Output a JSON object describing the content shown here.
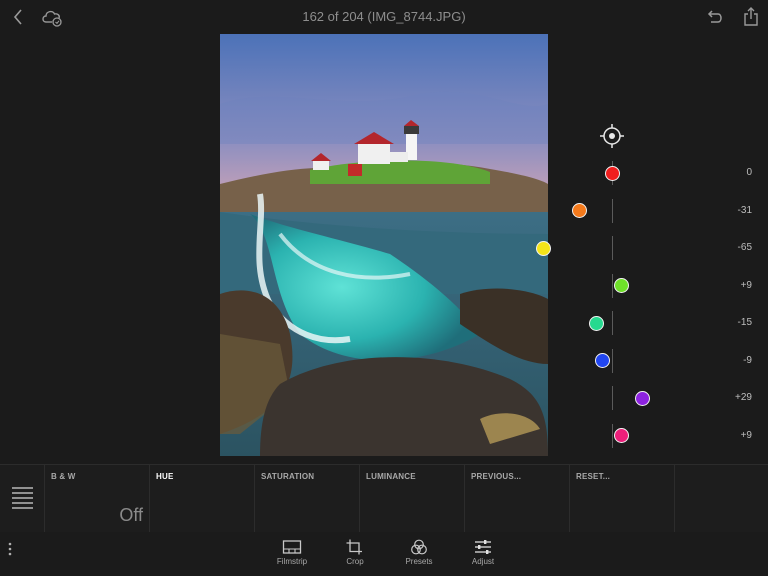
{
  "header": {
    "title": "162 of 204 (IMG_8744.JPG)",
    "icons": [
      "chevron-left-icon",
      "cloud-sync-icon",
      "undo-icon",
      "share-icon"
    ]
  },
  "hue_panel": {
    "target_tool_icon": "target-adjust-icon",
    "channels": [
      {
        "color": "#f01e1e",
        "value": "0",
        "level": 0
      },
      {
        "color": "#f47a1c",
        "value": "-31",
        "level": -31
      },
      {
        "color": "#f4e51a",
        "value": "-65",
        "level": -65
      },
      {
        "color": "#6fe02a",
        "value": "+9",
        "level": 9
      },
      {
        "color": "#26d98f",
        "value": "-15",
        "level": -15
      },
      {
        "color": "#2146f0",
        "value": "-9",
        "level": -9
      },
      {
        "color": "#8d22e0",
        "value": "+29",
        "level": 29
      },
      {
        "color": "#ec1f7a",
        "value": "+9",
        "level": 9
      }
    ]
  },
  "panel": {
    "tabs": [
      {
        "label": "B & W",
        "value": "Off",
        "active": false
      },
      {
        "label": "HUE",
        "value": "",
        "active": true
      },
      {
        "label": "SATURATION",
        "value": "",
        "active": false
      },
      {
        "label": "LUMINANCE",
        "value": "",
        "active": false
      },
      {
        "label": "PREVIOUS...",
        "value": "",
        "active": false
      },
      {
        "label": "RESET...",
        "value": "",
        "active": false
      }
    ]
  },
  "toolbar": {
    "tools": [
      {
        "label": "Filmstrip",
        "icon": "filmstrip-icon"
      },
      {
        "label": "Crop",
        "icon": "crop-icon"
      },
      {
        "label": "Presets",
        "icon": "presets-icon"
      },
      {
        "label": "Adjust",
        "icon": "adjust-sliders-icon"
      }
    ]
  }
}
